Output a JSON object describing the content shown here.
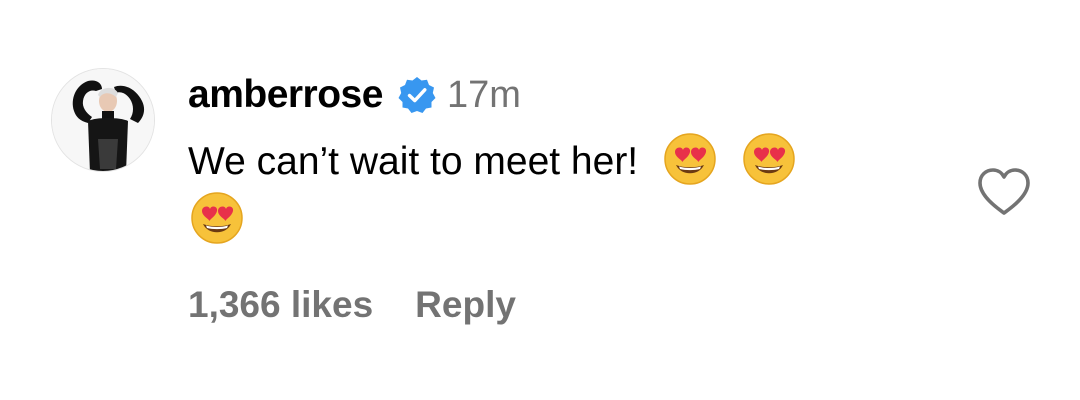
{
  "comment": {
    "username": "amberrose",
    "verified": true,
    "timestamp": "17m",
    "text": "We can’t wait to meet her!",
    "emojis": [
      "heart-eyes-emoji",
      "heart-eyes-emoji",
      "heart-eyes-emoji"
    ],
    "likes_label": "1,366 likes",
    "reply_label": "Reply",
    "like_icon": "heart-outline-icon"
  },
  "colors": {
    "verified_blue": "#3897f0",
    "meta_gray": "#737373",
    "emoji_yellow": "#f7c23a",
    "emoji_heart_red": "#e8304a"
  }
}
